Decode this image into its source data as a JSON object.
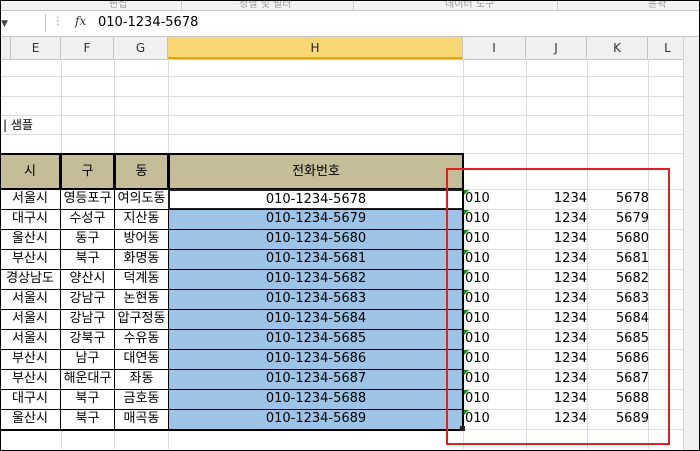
{
  "ribbon": {
    "groups": [
      "편집",
      "정렬 및 필터",
      "데이터 도구",
      "윤곽"
    ]
  },
  "formula_bar": {
    "fx_label": "fx",
    "formula": "010-1234-5678"
  },
  "columns": [
    "E",
    "F",
    "G",
    "H",
    "I",
    "J",
    "K",
    "L"
  ],
  "selected_column": "H",
  "sheet": {
    "sample_label": "| 샘플",
    "table": {
      "headers": [
        "시",
        "구",
        "동",
        "전화번호"
      ],
      "rows": [
        [
          "서울시",
          "영등포구",
          "여의도동",
          "010-1234-5678"
        ],
        [
          "대구시",
          "수성구",
          "지산동",
          "010-1234-5679"
        ],
        [
          "울산시",
          "동구",
          "방어동",
          "010-1234-5680"
        ],
        [
          "부산시",
          "북구",
          "화명동",
          "010-1234-5681"
        ],
        [
          "경상남도",
          "양산시",
          "덕계동",
          "010-1234-5682"
        ],
        [
          "서울시",
          "강남구",
          "논현동",
          "010-1234-5683"
        ],
        [
          "서울시",
          "강남구",
          "압구정동",
          "010-1234-5684"
        ],
        [
          "서울시",
          "강북구",
          "수유동",
          "010-1234-5685"
        ],
        [
          "부산시",
          "남구",
          "대연동",
          "010-1234-5686"
        ],
        [
          "부산시",
          "해운대구",
          "좌동",
          "010-1234-5687"
        ],
        [
          "대구시",
          "북구",
          "금호동",
          "010-1234-5688"
        ],
        [
          "울산시",
          "북구",
          "매곡동",
          "010-1234-5689"
        ]
      ]
    },
    "split": {
      "col_i": [
        "010",
        "010",
        "010",
        "010",
        "010",
        "010",
        "010",
        "010",
        "010",
        "010",
        "010",
        "010"
      ],
      "col_j": [
        "1234",
        "1234",
        "1234",
        "1234",
        "1234",
        "1234",
        "1234",
        "1234",
        "1234",
        "1234",
        "1234",
        "1234"
      ],
      "col_k": [
        "5678",
        "5679",
        "5680",
        "5681",
        "5682",
        "5683",
        "5684",
        "5685",
        "5686",
        "5687",
        "5688",
        "5689"
      ]
    }
  },
  "colors": {
    "header_fill": "#c4bd97",
    "selection_fill": "#9dc3e6",
    "highlight_box": "#e02020",
    "column_selected": "#f9d874"
  }
}
